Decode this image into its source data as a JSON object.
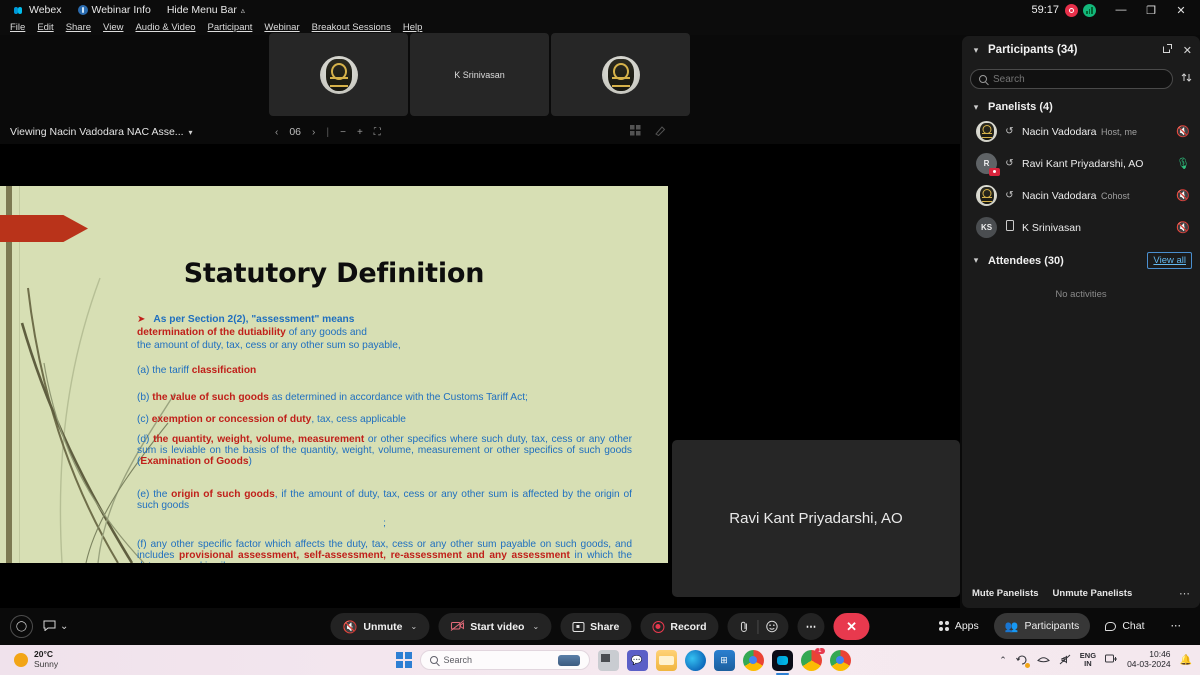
{
  "titlebar": {
    "app_name": "Webex",
    "webinar_info": "Webinar Info",
    "hide_menu": "Hide Menu Bar",
    "timer": "59:17",
    "minimize": "—",
    "maximize": "❐",
    "close": "✕"
  },
  "menubar": {
    "items": [
      "File",
      "Edit",
      "Share",
      "View",
      "Audio & Video",
      "Participant",
      "Webinar",
      "Breakout Sessions",
      "Help"
    ]
  },
  "filmstrip": {
    "tiles": [
      {
        "name": "",
        "type": "emblem-avatar"
      },
      {
        "name": "K Srinivasan",
        "type": "name-only"
      },
      {
        "name": "",
        "type": "emblem-avatar"
      }
    ]
  },
  "sharebar": {
    "viewing_label": "Viewing Nacin Vadodara NAC Asse...",
    "prev": "‹",
    "page": "06",
    "next": "›",
    "separator": "|",
    "zoom_out": "−",
    "zoom_in": "+",
    "fit": "⛶",
    "grid_icon": "grid-view-icon",
    "annotate_icon": "annotate-icon"
  },
  "slide": {
    "title": "Statutory Definition",
    "bullet_lead_blue_1": "As per Section 2(2), \"assessment\" means",
    "lead_red": "determination of the dutiability",
    "lead_blue_2": " of any goods and",
    "lead_line_3": "the amount of duty, tax, cess or any other sum so payable,",
    "item_a_prefix": "(a) the tariff ",
    "item_a_red": "classification",
    "item_b_prefix": "(b)  ",
    "item_b_red": "the  value  of  such  goods",
    "item_b_rest": "  as  determined  in  accordance  with  the  Customs  Tariff  Act;",
    "item_c_prefix": "(c) ",
    "item_c_red": "exemption or concession of duty",
    "item_c_rest": ", tax, cess applicable",
    "item_d_prefix": "(d)  ",
    "item_d_red": "the  quantity,  weight,  volume,  measurement",
    "item_d_rest": "  or  other  specifics  where  such  duty,  tax,  cess  or any  other  sum  is  leviable  on  the  basis  of  the  quantity,  weight,  volume,  measurement  or  other specifics of such goods (",
    "item_d_red2": "Examination of Goods",
    "item_d_tail": ")",
    "item_e_prefix": "(e) the ",
    "item_e_red": "origin of such goods",
    "item_e_rest": ", if the amount of duty, tax, cess or any other sum is affected by the origin of such goods",
    "semicolon": ";",
    "item_f_prefix": "(f) any  other  specific  factor  which  affects  the  duty,  tax,  cess  or  any  other  sum  payable  on  such goods,   and   includes   ",
    "item_f_red": "provisional   assessment,   self-assessment,   re-assessment   and   any assessment",
    "item_f_rest": " in which the duty assessed is nil"
  },
  "speaker_tile": {
    "name": "Ravi Kant Priyadarshi, AO"
  },
  "panel": {
    "title": "Participants (34)",
    "count": 34,
    "popout_icon": "popout-icon",
    "close_icon": "close-icon",
    "search": {
      "placeholder": "Search",
      "value": ""
    },
    "sort_icon": "sort-icon",
    "panelists_label": "Panelists (4)",
    "panelists": [
      {
        "name": "Nacin Vadodara",
        "sub": "Host, me",
        "avatar": "emblem",
        "initials": "",
        "device_icon": "audio-icon",
        "mic": "muted",
        "recording_badge": false
      },
      {
        "name": "Ravi Kant Priyadarshi, AO",
        "sub": "",
        "avatar": "initials",
        "initials": "R",
        "device_icon": "audio-icon",
        "mic": "on",
        "recording_badge": true
      },
      {
        "name": "Nacin Vadodara",
        "sub": "Cohost",
        "avatar": "emblem",
        "initials": "",
        "device_icon": "audio-icon",
        "mic": "muted",
        "recording_badge": false
      },
      {
        "name": "K Srinivasan",
        "sub": "",
        "avatar": "initials",
        "initials": "KS",
        "device_icon": "mobile-icon",
        "mic": "muted",
        "recording_badge": false
      }
    ],
    "attendees_label": "Attendees (30)",
    "view_all": "View all",
    "no_activities": "No activities",
    "footer": {
      "mute_panelists": "Mute Panelists",
      "unmute_panelists": "Unmute Panelists",
      "more": "⋯"
    }
  },
  "controls": {
    "left": {
      "record_circle_icon": "circle-icon",
      "chat_bubble_icon": "chat-bubble-icon",
      "chat_caret": "⌄"
    },
    "unmute": "Unmute",
    "start_video": "Start video",
    "share": "Share",
    "record": "Record",
    "caret": "⌄",
    "clip_icon": "paperclip-icon",
    "reaction_icon": "reaction-icon",
    "more": "⋯",
    "end_call": "✕",
    "right": {
      "apps": "Apps",
      "participants": "Participants",
      "chat": "Chat",
      "more": "⋯"
    }
  },
  "taskbar": {
    "weather_temp": "20°C",
    "weather_desc": "Sunny",
    "search_placeholder": "Search",
    "icons": [
      "start-icon",
      "widgets-icon",
      "file-explorer-icon",
      "teams-icon",
      "edge-icon",
      "store-icon",
      "chrome-icon",
      "webex-icon",
      "meet-icon",
      "chrome-icon-2"
    ],
    "tray": {
      "chevron": "⌃",
      "lang_line1": "ENG",
      "lang_line2": "IN",
      "time": "10:46",
      "date": "04-03-2024"
    }
  }
}
